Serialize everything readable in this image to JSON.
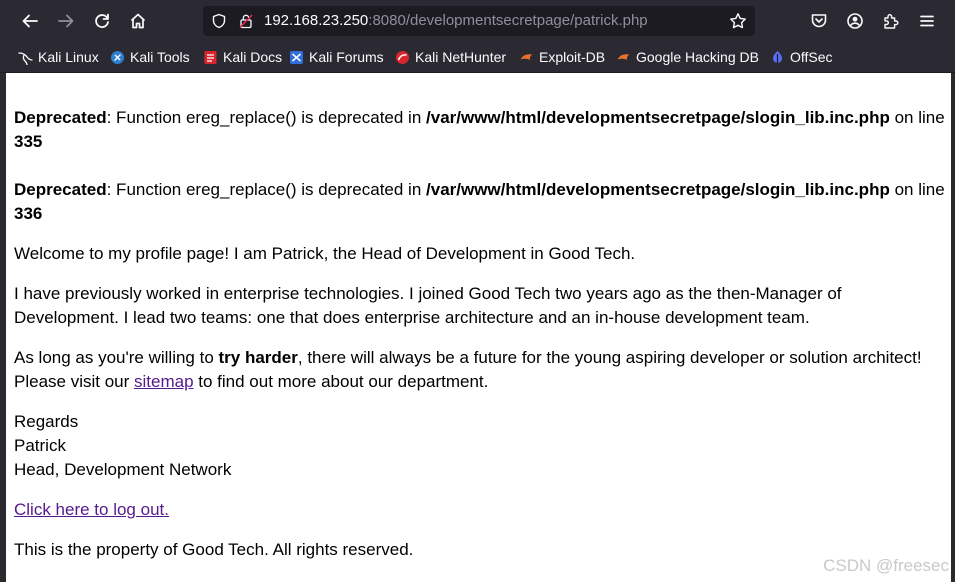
{
  "browser": {
    "url_host": "192.168.23.250",
    "url_rest": ":8080/developmentsecretpage/patrick.php",
    "bookmarks": [
      {
        "label": "Kali Linux",
        "icon": "kali-dragon-icon"
      },
      {
        "label": "Kali Tools",
        "icon": "kali-tools-icon"
      },
      {
        "label": "Kali Docs",
        "icon": "kali-docs-icon"
      },
      {
        "label": "Kali Forums",
        "icon": "kali-forums-icon"
      },
      {
        "label": "Kali NetHunter",
        "icon": "nethunter-icon"
      },
      {
        "label": "Exploit-DB",
        "icon": "exploit-db-icon"
      },
      {
        "label": "Google Hacking DB",
        "icon": "ghdb-icon"
      },
      {
        "label": "OffSec",
        "icon": "offsec-icon"
      }
    ]
  },
  "page": {
    "warning1": {
      "label": "Deprecated",
      "text": ": Function ereg_replace() is deprecated in ",
      "path": "/var/www/html/developmentsecretpage/slogin_lib.inc.php",
      "on_line": " on line",
      "line": "335"
    },
    "warning2": {
      "label": "Deprecated",
      "text": ": Function ereg_replace() is deprecated in ",
      "path": "/var/www/html/developmentsecretpage/slogin_lib.inc.php",
      "on_line": " on line",
      "line": "336"
    },
    "welcome": "Welcome to my profile page! I am Patrick, the Head of Development in Good Tech.",
    "history": "I have previously worked in enterprise technologies. I joined Good Tech two years ago as the then-Manager of Development. I lead two teams: one that does enterprise architecture and an in-house development team.",
    "tryharder_pre": "As long as you're willing to ",
    "tryharder_bold": "try harder",
    "tryharder_post": ", there will always be a future for the young aspiring developer or solution architect! Please visit our ",
    "sitemap_link": "sitemap",
    "tryharder_end": " to find out more about our department.",
    "sign1": "Regards",
    "sign2": "Patrick",
    "sign3": "Head, Development Network",
    "logout_link": "Click here to log out.",
    "footer": "This is the property of Good Tech. All rights reserved."
  },
  "watermark": "CSDN @freesec"
}
